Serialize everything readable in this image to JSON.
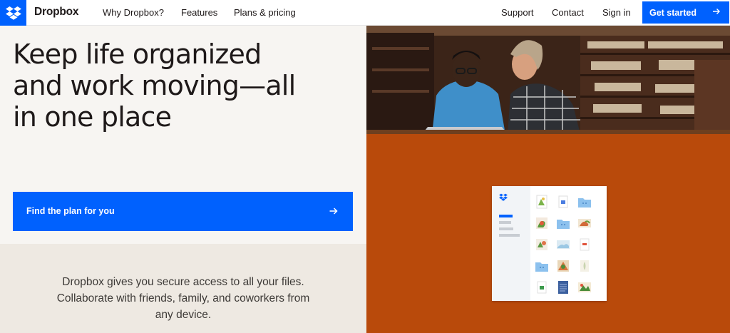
{
  "header": {
    "brand": "Dropbox",
    "logo_icon": "dropbox-logo-icon",
    "nav": [
      "Why Dropbox?",
      "Features",
      "Plans & pricing"
    ],
    "right_nav": [
      "Support",
      "Contact",
      "Sign in"
    ],
    "cta_label": "Get started",
    "cta_icon": "arrow-right-icon"
  },
  "hero": {
    "headline_lines": [
      "Keep life organized",
      "and work moving—all",
      "in one place"
    ],
    "plan_button": "Find the plan for you",
    "plan_button_icon": "arrow-right-icon",
    "description_lines": [
      "Dropbox gives you secure access to all your files.",
      "Collaborate with friends, family, and coworkers from",
      "any device."
    ]
  },
  "colors": {
    "accent": "#0061fe",
    "hero_background": "#f7f5f2",
    "description_background": "#eee9e2",
    "panel_orange": "#b94a0b"
  },
  "illustration": {
    "photo": "two-people-at-laptop-in-library",
    "app_preview_icons": [
      "dropbox-logo-icon",
      "image-thumbnail-icon",
      "document-icon",
      "folder-icon"
    ]
  }
}
